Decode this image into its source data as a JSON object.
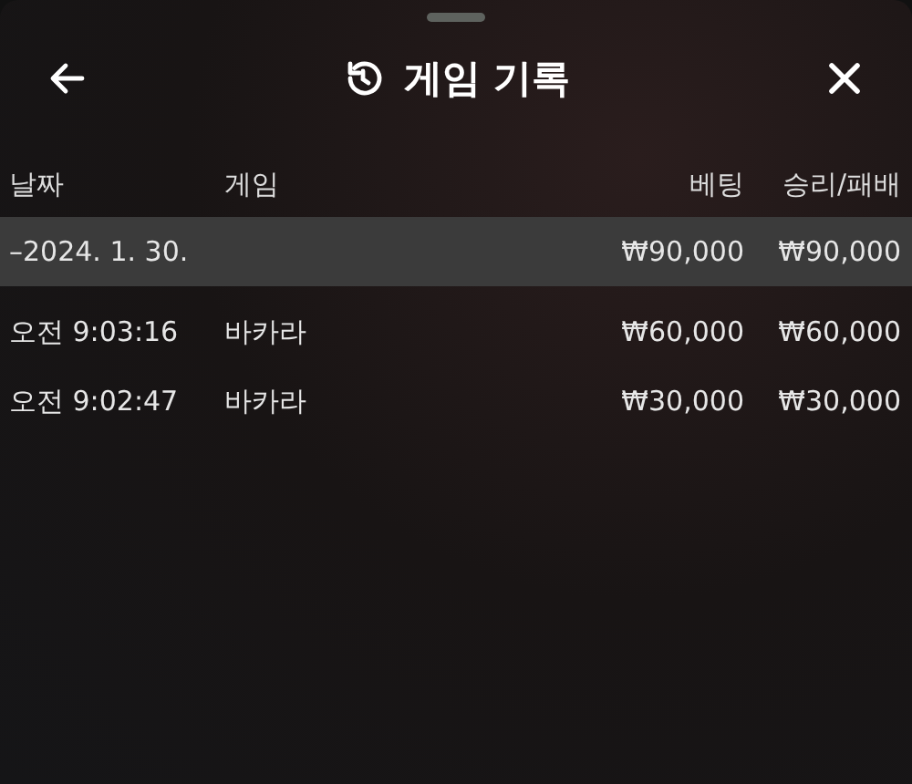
{
  "header": {
    "title": "게임 기록"
  },
  "table": {
    "columns": [
      "날짜",
      "게임",
      "베팅",
      "승리/패배"
    ],
    "rows": [
      {
        "kind": "group",
        "date": "–2024. 1. 30.",
        "bet": "₩90,000",
        "result": "₩90,000"
      },
      {
        "kind": "entry",
        "date": "오전 9:03:16",
        "game": "바카라",
        "bet": "₩60,000",
        "result": "₩60,000"
      },
      {
        "kind": "entry",
        "date": "오전 9:02:47",
        "game": "바카라",
        "bet": "₩30,000",
        "result": "₩30,000"
      }
    ]
  }
}
